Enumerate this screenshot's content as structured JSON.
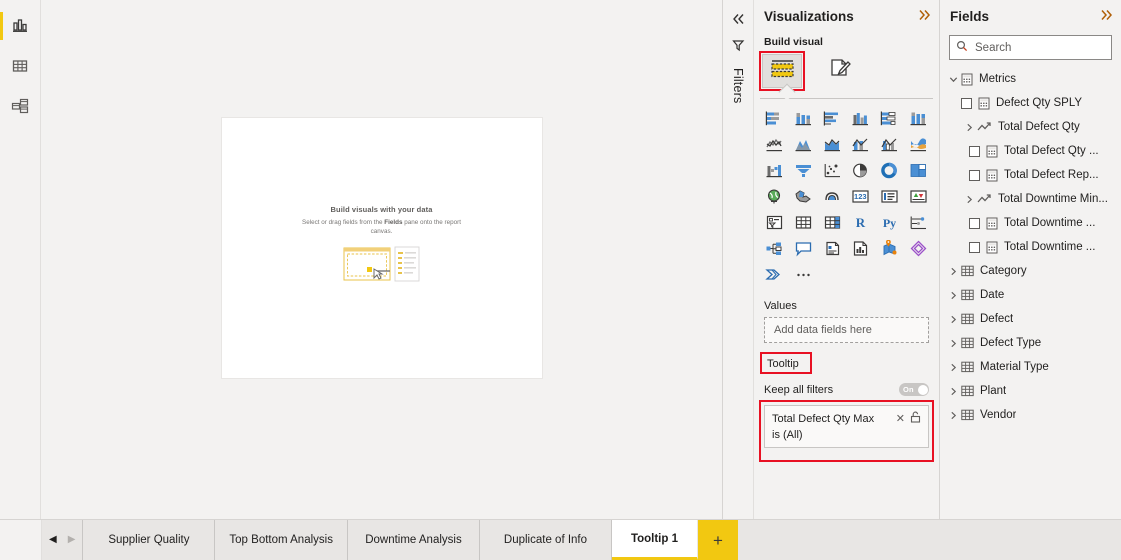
{
  "left_rail": {
    "items": [
      {
        "name": "report-view",
        "icon": "bar-chart-icon",
        "active": true
      },
      {
        "name": "data-view",
        "icon": "table-icon",
        "active": false
      },
      {
        "name": "model-view",
        "icon": "model-relationships-icon",
        "active": false
      }
    ]
  },
  "canvas": {
    "placeholder_title": "Build visuals with your data",
    "placeholder_subtitle_1": "Select or drag fields from the ",
    "placeholder_subtitle_bold": "Fields",
    "placeholder_subtitle_2": " pane",
    "placeholder_subtitle_3": "onto the report canvas."
  },
  "filters_strip": {
    "collapse_icon": "chevron-double-left-icon",
    "label": "Filters",
    "filter_icon": "filter-icon"
  },
  "visualizations": {
    "title": "Visualizations",
    "expand_icon": "chevron-double-right-icon",
    "build_visual_label": "Build visual",
    "tabs": [
      {
        "name": "build-visual-tab",
        "icon": "fields-build-icon",
        "selected": true,
        "highlighted": true
      },
      {
        "name": "format-visual-tab",
        "icon": "paint-brush-page-icon",
        "selected": false,
        "highlighted": false
      }
    ],
    "icon_grid": [
      "stacked-bar-chart-icon",
      "stacked-column-chart-icon",
      "clustered-bar-chart-icon",
      "clustered-column-chart-icon",
      "100-stacked-bar-chart-icon",
      "100-stacked-column-chart-icon",
      "line-chart-icon",
      "area-chart-icon",
      "stacked-area-chart-icon",
      "line-and-stacked-column-chart-icon",
      "line-and-clustered-column-chart-icon",
      "ribbon-chart-icon",
      "waterfall-chart-icon",
      "funnel-chart-icon",
      "scatter-chart-icon",
      "pie-chart-icon",
      "donut-chart-icon",
      "treemap-icon",
      "map-icon",
      "filled-map-icon",
      "arcgis-map-icon",
      "card-icon",
      "multi-row-card-icon",
      "kpi-icon",
      "slicer-icon",
      "table-icon",
      "matrix-icon",
      "r-script-visual-icon",
      "python-visual-icon",
      "key-influencers-icon",
      "decomposition-tree-icon",
      "qa-visual-icon",
      "smart-narrative-icon",
      "paginated-report-icon",
      "azure-map-icon",
      "power-apps-icon",
      "power-automate-icon",
      "more-options-icon"
    ],
    "values_label": "Values",
    "values_placeholder": "Add data fields here",
    "tooltip_label": "Tooltip",
    "keep_all_filters_label": "Keep all filters",
    "keep_all_filters_state": "On",
    "filter_card": {
      "field_name": "Total Defect Qty Max",
      "remove_icon": "close-x-icon",
      "lock_icon": "unlocked-padlock-icon",
      "condition": "is (All)"
    },
    "highlight_color": "#e81123"
  },
  "fields": {
    "title": "Fields",
    "expand_icon": "chevron-double-right-icon",
    "search_placeholder": "Search",
    "search_value": "",
    "search_icon": "search-icon",
    "tree": [
      {
        "label": "Metrics",
        "level": 0,
        "expander": "chevron-down-icon",
        "icon": "measure-table-icon",
        "checkbox": false
      },
      {
        "label": "Defect Qty SPLY",
        "level": 1,
        "expander": "none",
        "icon": "measure-icon",
        "checkbox": true
      },
      {
        "label": "Total Defect Qty",
        "level": 1,
        "expander": "chevron-right-icon",
        "icon": "measure-folder-icon",
        "checkbox": false
      },
      {
        "label": "Total Defect Qty ...",
        "level": 2,
        "expander": "none",
        "icon": "measure-icon",
        "checkbox": true
      },
      {
        "label": "Total Defect Rep...",
        "level": 2,
        "expander": "none",
        "icon": "measure-icon",
        "checkbox": true
      },
      {
        "label": "Total Downtime Min...",
        "level": 1,
        "expander": "chevron-right-icon",
        "icon": "measure-folder-icon",
        "checkbox": false
      },
      {
        "label": "Total Downtime ...",
        "level": 2,
        "expander": "none",
        "icon": "measure-icon",
        "checkbox": true
      },
      {
        "label": "Total Downtime ...",
        "level": 2,
        "expander": "none",
        "icon": "measure-icon",
        "checkbox": true
      },
      {
        "label": "Category",
        "level": 0,
        "expander": "chevron-right-icon",
        "icon": "table-icon",
        "checkbox": false
      },
      {
        "label": "Date",
        "level": 0,
        "expander": "chevron-right-icon",
        "icon": "table-icon",
        "checkbox": false
      },
      {
        "label": "Defect",
        "level": 0,
        "expander": "chevron-right-icon",
        "icon": "table-icon",
        "checkbox": false
      },
      {
        "label": "Defect Type",
        "level": 0,
        "expander": "chevron-right-icon",
        "icon": "table-icon",
        "checkbox": false
      },
      {
        "label": "Material Type",
        "level": 0,
        "expander": "chevron-right-icon",
        "icon": "table-icon",
        "checkbox": false
      },
      {
        "label": "Plant",
        "level": 0,
        "expander": "chevron-right-icon",
        "icon": "table-icon",
        "checkbox": false
      },
      {
        "label": "Vendor",
        "level": 0,
        "expander": "chevron-right-icon",
        "icon": "table-icon",
        "checkbox": false
      }
    ]
  },
  "page_tabs": {
    "prev_icon": "triangle-left-icon",
    "next_icon": "triangle-right-icon",
    "tabs": [
      {
        "label": "Supplier Quality",
        "active": false
      },
      {
        "label": "Top Bottom Analysis",
        "active": false
      },
      {
        "label": "Downtime Analysis",
        "active": false
      },
      {
        "label": "Duplicate of Info",
        "active": false
      },
      {
        "label": "Tooltip 1",
        "active": true
      }
    ],
    "add_label": "+",
    "add_color": "#f2c811"
  }
}
